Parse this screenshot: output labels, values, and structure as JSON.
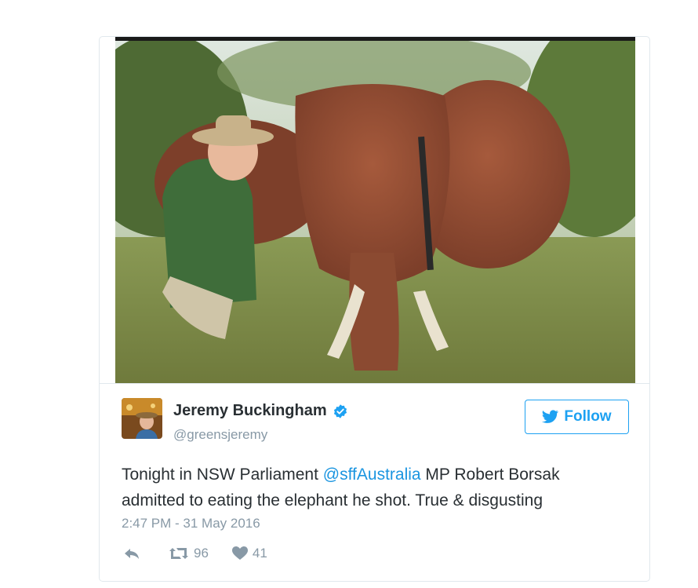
{
  "tweet": {
    "display_name": "Jeremy Buckingham",
    "handle": "@greensjeremy",
    "verified": true,
    "follow_label": "Follow",
    "text_before": "Tonight in NSW Parliament ",
    "mention": "@sffAustralia",
    "text_after": " MP Robert Borsak admitted to eating the elephant he shot. True & disgusting",
    "timestamp": "2:47 PM - 31 May 2016",
    "retweets": "96",
    "likes": "41"
  },
  "icons": {
    "reply": "reply-icon",
    "retweet": "retweet-icon",
    "like": "heart-icon",
    "verified": "verified-badge-icon",
    "follow": "twitter-bird-icon"
  },
  "colors": {
    "accent": "#1da1f2",
    "mention": "#1b95e0",
    "muted": "#8899a6",
    "text": "#292f33",
    "border": "#e1e8ed"
  }
}
